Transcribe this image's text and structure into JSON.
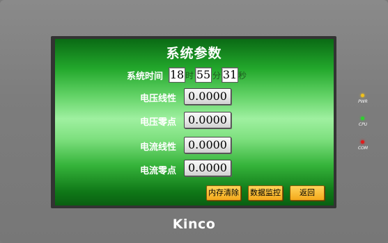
{
  "title": "系统参数",
  "system_time": {
    "label": "系统时间",
    "hour": "18",
    "hour_unit": "时",
    "minute": "55",
    "minute_unit": "分",
    "second": "31",
    "second_unit": "秒"
  },
  "params": [
    {
      "label": "电压线性",
      "value": "0.0000"
    },
    {
      "label": "电压零点",
      "value": "0.0000"
    },
    {
      "label": "电流线性",
      "value": "0.0000"
    },
    {
      "label": "电流零点",
      "value": "0.0000"
    }
  ],
  "buttons": {
    "clear_memory": "内存清除",
    "data_monitor": "数据监控",
    "back": "返回"
  },
  "indicators": [
    {
      "label": "PWR",
      "color": "#f2c21a"
    },
    {
      "label": "CPU",
      "color": "#2ed12e"
    },
    {
      "label": "COM",
      "color": "#e21a1a"
    }
  ],
  "brand": "Kinco"
}
